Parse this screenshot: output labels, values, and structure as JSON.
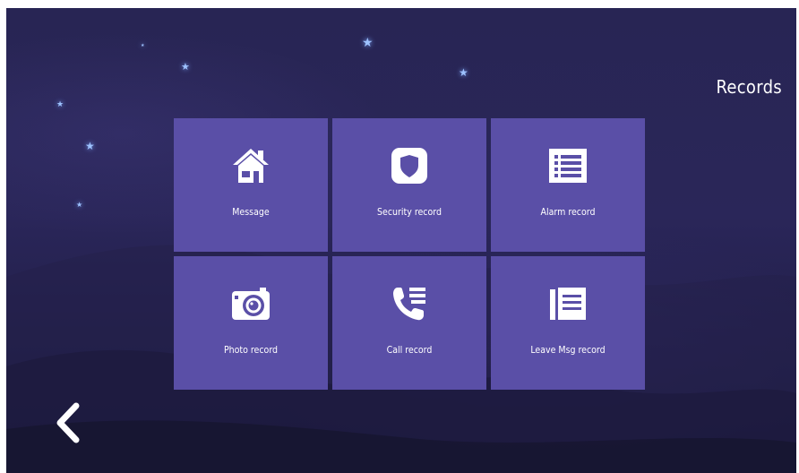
{
  "screen": {
    "title": "Records"
  },
  "tiles": [
    {
      "label": "Message",
      "icon": "home-icon"
    },
    {
      "label": "Security record",
      "icon": "shield-icon"
    },
    {
      "label": "Alarm record",
      "icon": "list-icon"
    },
    {
      "label": "Photo record",
      "icon": "camera-icon"
    },
    {
      "label": "Call record",
      "icon": "phone-list-icon"
    },
    {
      "label": "Leave Msg record",
      "icon": "message-board-icon"
    }
  ],
  "nav": {
    "back_icon": "chevron-left-icon"
  },
  "colors": {
    "background": "#282554",
    "tile": "#5a4fa7",
    "text": "#ffffff"
  }
}
